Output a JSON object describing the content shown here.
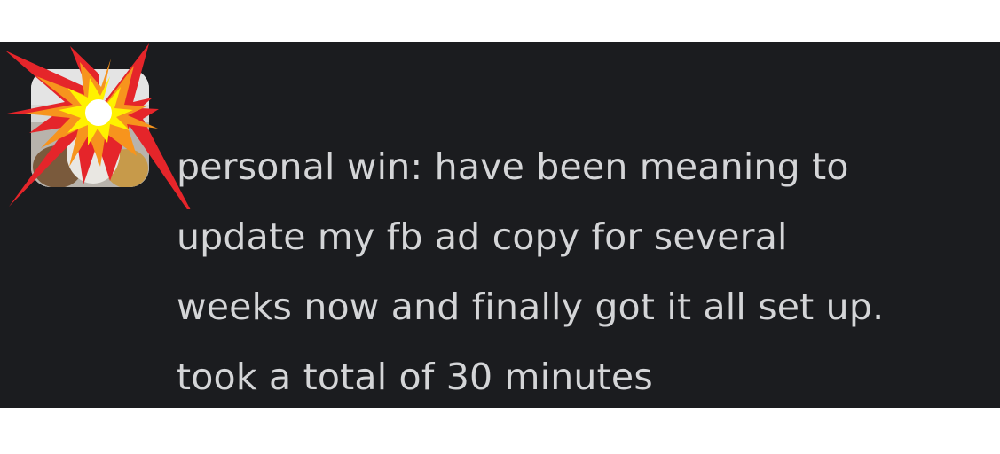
{
  "message": {
    "text": "personal win: have been meaning to\nupdate my fb ad copy for several\nweeks now and finally got it all set up.\ntook a total of 30 minutes"
  },
  "avatar": {
    "icon": "user-avatar-photo"
  },
  "overlay": {
    "icon": "collision-emoji-icon"
  },
  "colors": {
    "panel_background": "#1b1c1f",
    "message_text": "#d4d5d7",
    "page_background": "#ffffff",
    "burst_red": "#e5252a",
    "burst_orange": "#f7941d",
    "burst_yellow": "#fff200"
  }
}
